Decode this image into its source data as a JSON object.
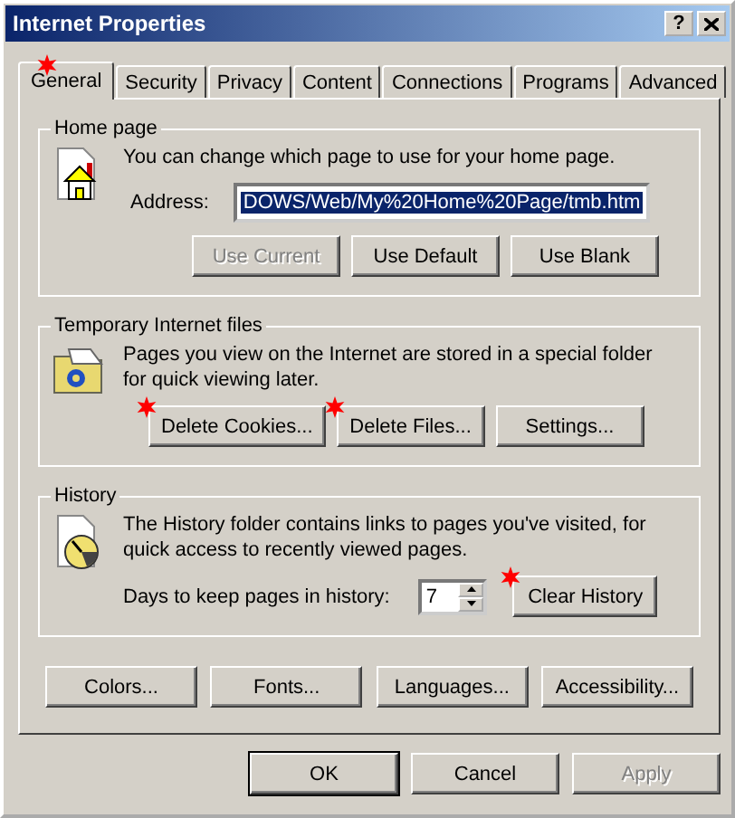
{
  "window": {
    "title": "Internet Properties",
    "help_button": "?"
  },
  "tabs": [
    {
      "label": "General",
      "selected": true,
      "marked": true
    },
    {
      "label": "Security",
      "selected": false,
      "marked": false
    },
    {
      "label": "Privacy",
      "selected": false,
      "marked": false
    },
    {
      "label": "Content",
      "selected": false,
      "marked": false
    },
    {
      "label": "Connections",
      "selected": false,
      "marked": false
    },
    {
      "label": "Programs",
      "selected": false,
      "marked": false
    },
    {
      "label": "Advanced",
      "selected": false,
      "marked": false
    }
  ],
  "home_page": {
    "title": "Home page",
    "description": "You can change which page to use for your home page.",
    "address_label": "Address:",
    "address_value": "DOWS/Web/My%20Home%20Page/tmb.htm",
    "address_highlighted": true,
    "buttons": [
      {
        "label": "Use Current",
        "disabled": true
      },
      {
        "label": "Use Default",
        "disabled": false
      },
      {
        "label": "Use Blank",
        "disabled": false
      }
    ]
  },
  "temporary_files": {
    "title": "Temporary Internet files",
    "description": "Pages you view on the Internet are stored in a special folder for quick viewing later.",
    "buttons": [
      {
        "label": "Delete Cookies...",
        "marked": true
      },
      {
        "label": "Delete Files...",
        "marked": true
      },
      {
        "label": "Settings...",
        "marked": false
      }
    ]
  },
  "history": {
    "title": "History",
    "description": "The History folder contains links to pages you've visited, for quick access to recently viewed pages.",
    "days_label": "Days to keep pages in history:",
    "days_value": "7",
    "button": {
      "label": "Clear History",
      "marked": true
    }
  },
  "bottom_buttons": [
    "Colors...",
    "Fonts...",
    "Languages...",
    "Accessibility..."
  ],
  "dialog_buttons": [
    {
      "label": "OK",
      "default": true,
      "disabled": false
    },
    {
      "label": "Cancel",
      "default": false,
      "disabled": false
    },
    {
      "label": "Apply",
      "default": false,
      "disabled": true
    }
  ]
}
